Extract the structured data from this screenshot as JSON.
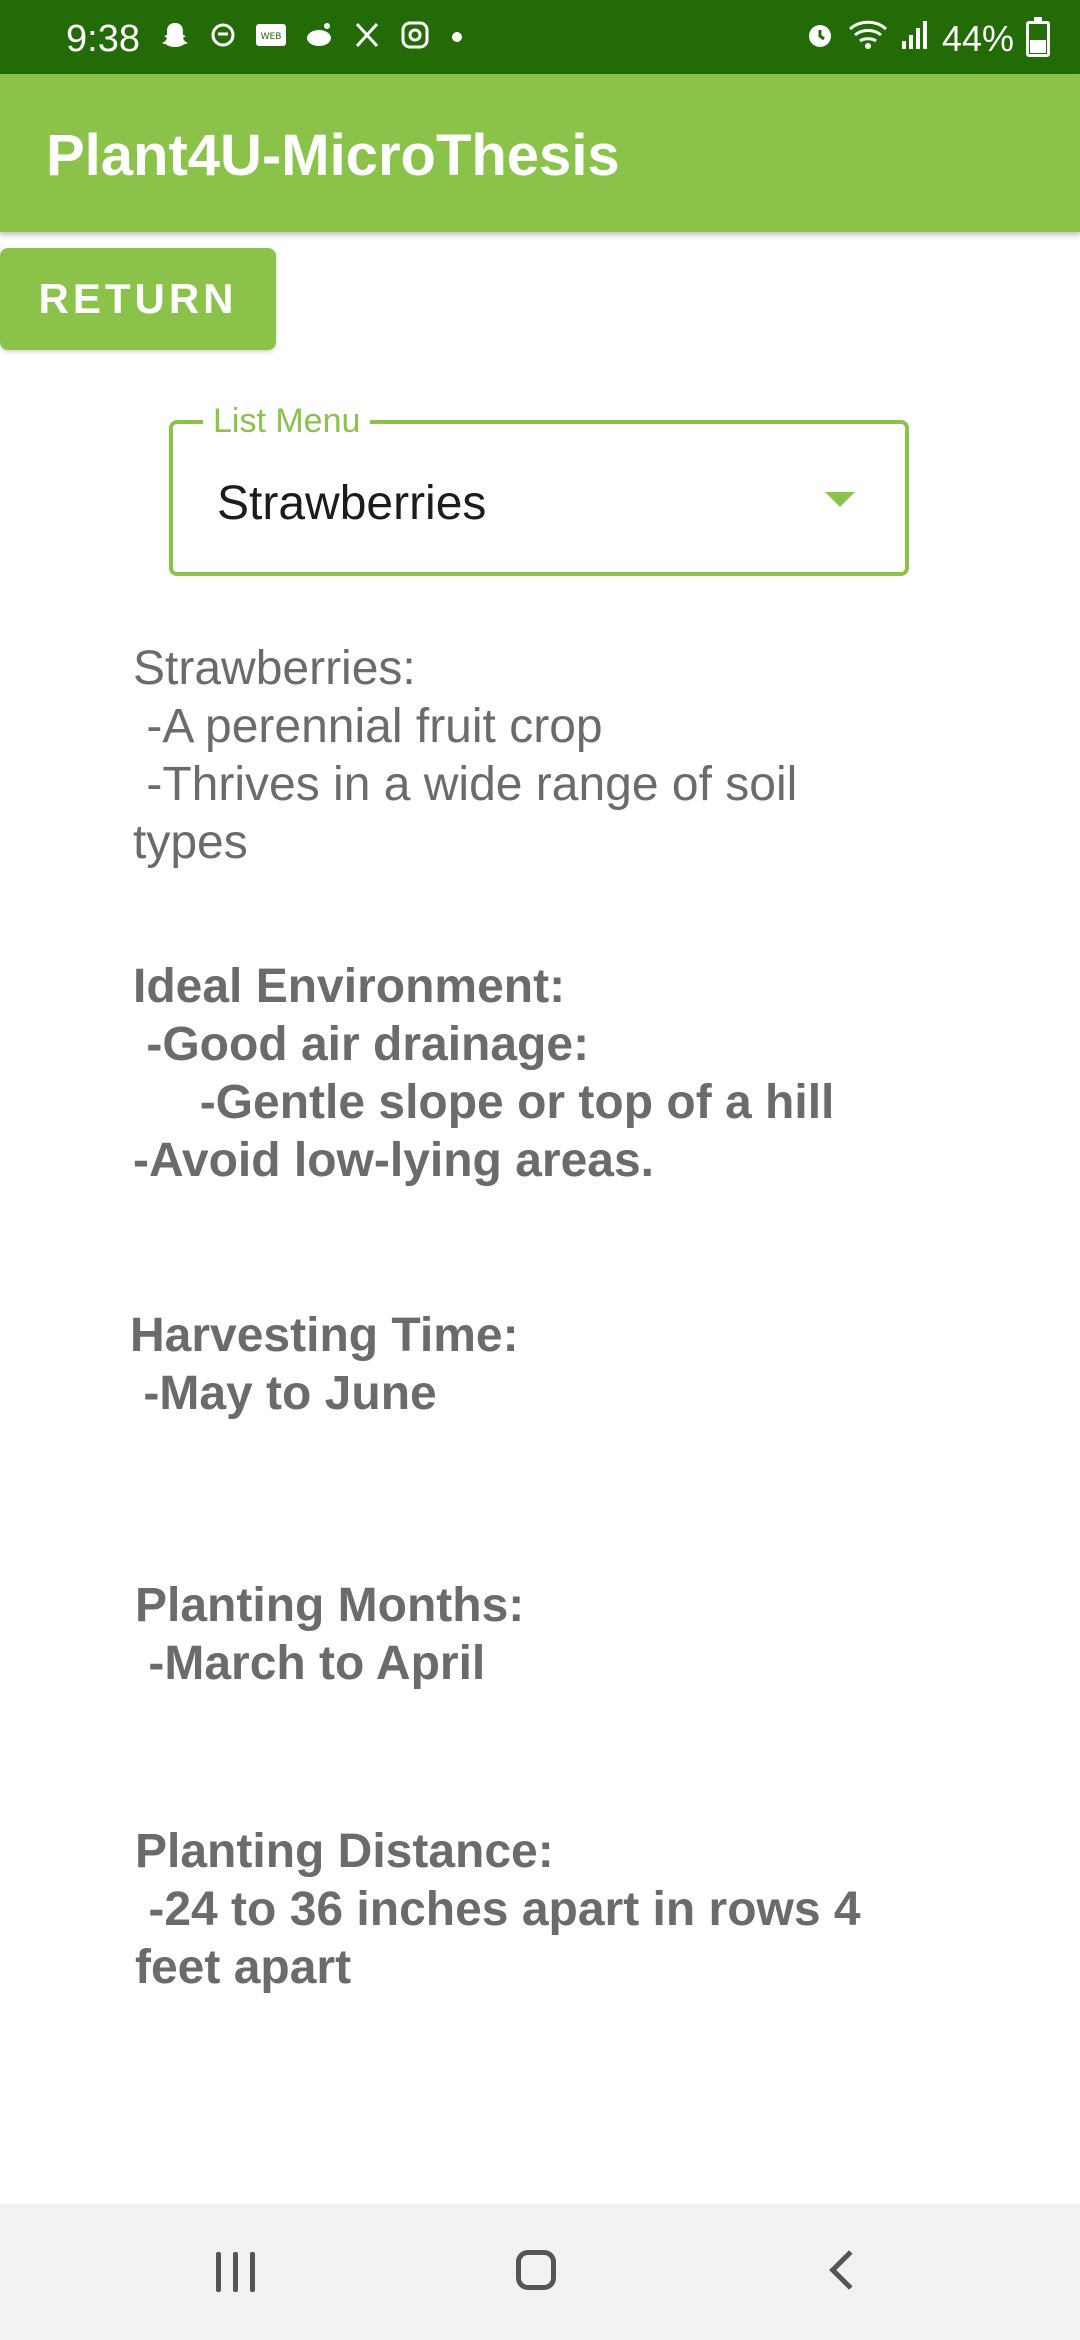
{
  "status_bar": {
    "time": "9:38",
    "left_icons": [
      "snapchat-icon",
      "threads-icon",
      "webtoon-icon",
      "reddit-icon",
      "x-icon",
      "instagram-icon",
      "more-dot-icon"
    ],
    "right_icons": [
      "alarm-icon",
      "wifi-icon",
      "signal-icon",
      "battery-icon"
    ],
    "battery": "44%"
  },
  "app_bar": {
    "title": "Plant4U-MicroThesis",
    "color": "#8bc34a"
  },
  "return_button": {
    "label": "RETURN"
  },
  "list_menu": {
    "label": "List Menu",
    "selected": "Strawberries"
  },
  "sections": {
    "intro": "Strawberries:\n -A perennial fruit crop\n -Thrives in a wide range of soil types",
    "environment": "Ideal Environment:\n -Good air drainage:\n     -Gentle slope or top of a hill\n-Avoid low-lying areas.",
    "harvesting": "Harvesting Time:\n -May to June",
    "planting_months": "Planting Months:\n -March to April",
    "planting_distance": "Planting Distance:\n -24 to 36 inches apart in rows 4 feet apart"
  },
  "nav_bar": {
    "icons": [
      "recent-apps-icon",
      "home-icon",
      "back-icon"
    ]
  }
}
